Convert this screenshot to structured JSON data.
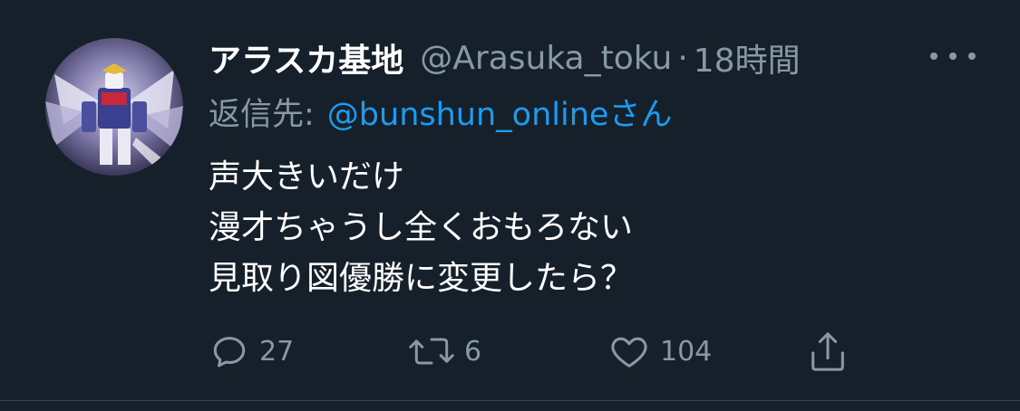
{
  "tweet": {
    "display_name": "アラスカ基地",
    "handle": "@Arasuka_toku",
    "separator": "·",
    "time": "18時間",
    "reply_prefix": "返信先:",
    "reply_mention": "@bunshun_onlineさん",
    "text_lines": [
      "声大きいだけ",
      "漫才ちゃうし全くおもろない",
      "見取り図優勝に変更したら？"
    ],
    "replies": "27",
    "retweets": "6",
    "likes": "104"
  },
  "icons": {
    "more": "more-dots-icon",
    "reply": "reply-bubble-icon",
    "retweet": "retweet-icon",
    "like": "heart-icon",
    "share": "share-icon"
  },
  "colors": {
    "background": "#15202b",
    "secondary_text": "#8899a6",
    "link": "#1d9bf0",
    "primary_text": "#ffffff"
  }
}
